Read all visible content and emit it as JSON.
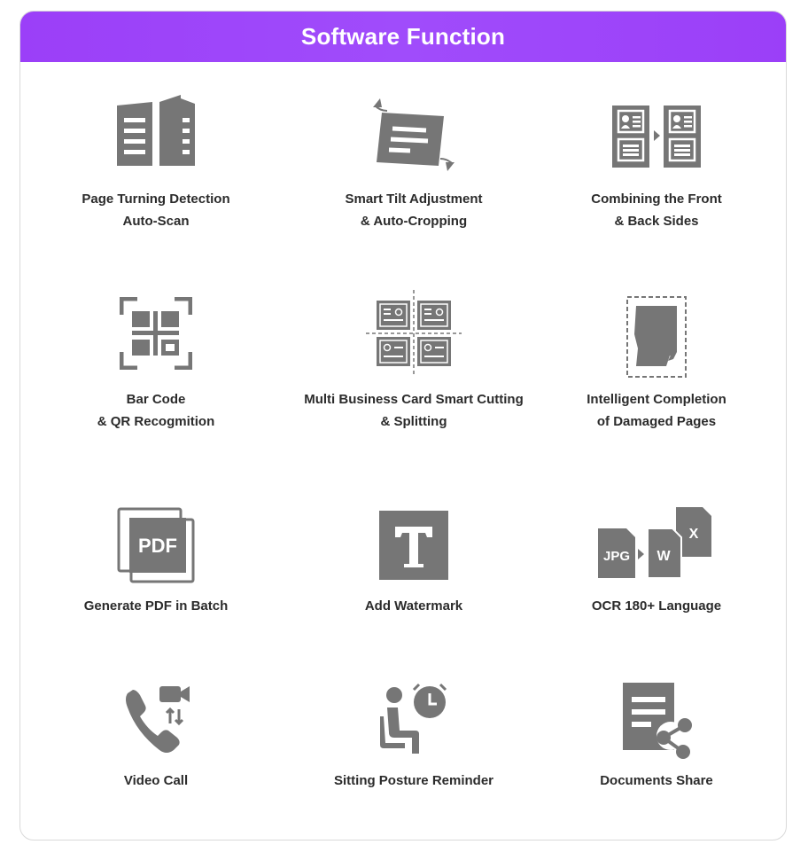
{
  "header": {
    "title": "Software Function"
  },
  "accent_color": "#9b3ff8",
  "icon_color": "#767676",
  "features": [
    {
      "icon": "book-open-icon",
      "line1": "Page Turning Detection",
      "line2": "Auto-Scan"
    },
    {
      "icon": "tilt-document-icon",
      "line1": "Smart Tilt Adjustment",
      "line2": "& Auto-Cropping"
    },
    {
      "icon": "id-card-combine-icon",
      "line1": "Combining the Front",
      "line2": "& Back Sides"
    },
    {
      "icon": "qr-code-icon",
      "line1": "Bar Code",
      "line2": "& QR Recogmition"
    },
    {
      "icon": "business-cards-cut-icon",
      "line1": "Multi Business Card Smart Cutting",
      "line2": "& Splitting"
    },
    {
      "icon": "damaged-page-icon",
      "line1": "Intelligent Completion",
      "line2": "of Damaged Pages"
    },
    {
      "icon": "pdf-icon",
      "icon_text": "PDF",
      "line1": "Generate PDF  in Batch",
      "line2": ""
    },
    {
      "icon": "text-watermark-icon",
      "line1": "Add Watermark",
      "line2": ""
    },
    {
      "icon": "ocr-languages-icon",
      "icon_texts": [
        "JPG",
        "W",
        "X"
      ],
      "line1": "OCR 180+ Language",
      "line2": ""
    },
    {
      "icon": "video-call-icon",
      "line1": "Video Call",
      "line2": ""
    },
    {
      "icon": "posture-reminder-icon",
      "line1": "Sitting Posture Reminder",
      "line2": ""
    },
    {
      "icon": "document-share-icon",
      "line1": "Documents Share",
      "line2": ""
    }
  ]
}
